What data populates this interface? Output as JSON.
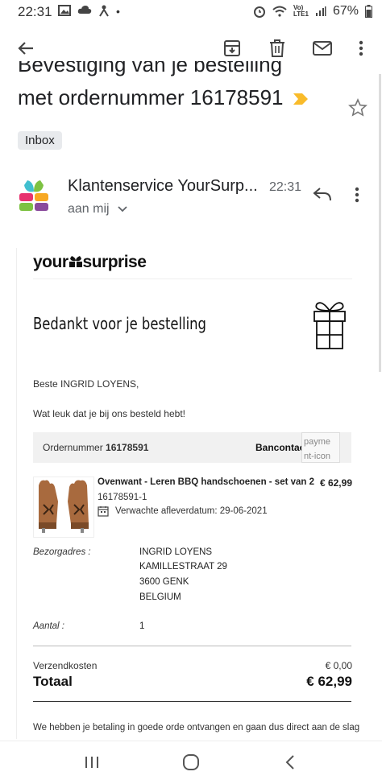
{
  "status": {
    "time": "22:31",
    "network_label": "Vo)\nLTE1",
    "battery": "67%"
  },
  "toolbar": {
    "back": "back",
    "archive": "archive",
    "delete": "delete",
    "mark_unread": "mark unread",
    "more": "more"
  },
  "email": {
    "subject_line1": "Bevestiging van je bestelling",
    "subject_line2": "met ordernummer 16178591",
    "label": "Inbox",
    "sender": "Klantenservice YourSurp...",
    "time": "22:31",
    "recipient": "aan mij"
  },
  "body": {
    "brand_prefix": "your",
    "brand_suffix": "surprise",
    "thanks": "Bedankt voor je bestelling",
    "greeting": "Beste INGRID LOYENS,",
    "intro": "Wat leuk dat je bij ons besteld hebt!",
    "order_label": "Ordernummer",
    "order_number": "16178591",
    "payment_method": "Bancontact",
    "payment_icon_alt": "payme nt-icon",
    "product": {
      "name": "Ovenwant - Leren BBQ handschoenen - set van 2",
      "price": "€ 62,99",
      "sku": "16178591-1",
      "delivery_label": "Verwachte afleverdatum: 29-06-2021"
    },
    "address_label": "Bezorgadres :",
    "address": [
      "INGRID LOYENS",
      "KAMILLESTRAAT 29",
      "3600 GENK",
      "BELGIUM"
    ],
    "qty_label": "Aantal :",
    "qty": "1",
    "shipping_label": "Verzendkosten",
    "shipping_value": "€ 0,00",
    "total_label": "Totaal",
    "total_value": "€ 62,99",
    "footer": "We hebben je betaling in goede orde ontvangen en gaan dus direct aan de slag"
  },
  "colors": {
    "important_marker": "#f9bb2a",
    "text": "#202124",
    "muted": "#5f6368",
    "order_bar": "#f1f1f1"
  }
}
